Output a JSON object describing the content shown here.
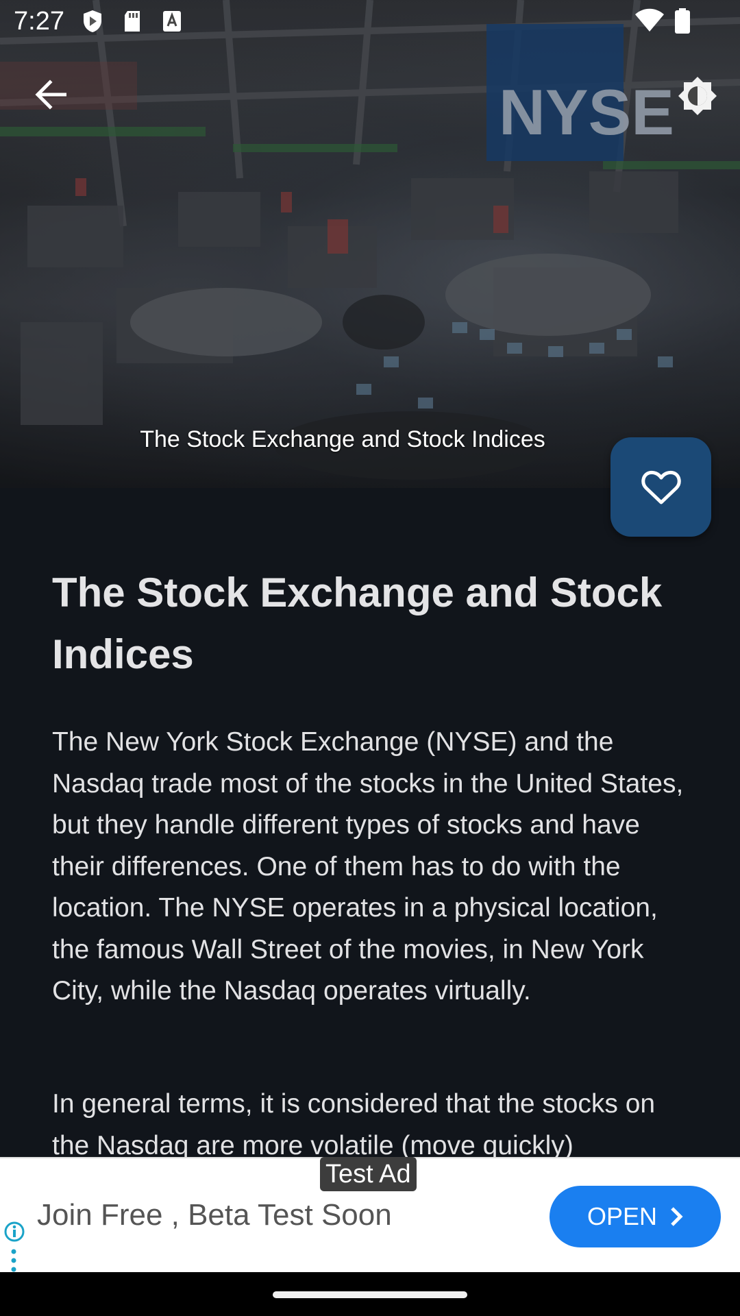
{
  "status_bar": {
    "time": "7:27"
  },
  "hero": {
    "caption": "The Stock Exchange and Stock Indices"
  },
  "article": {
    "title": "The Stock Exchange and Stock Indices",
    "paragraphs": [
      "The New York Stock Exchange (NYSE) and the Nasdaq trade most of the stocks in the United States, but they handle different types of stocks and have their differences. One of them has to do with the location. The NYSE operates in a physical location, the famous Wall Street of the movies, in New York City, while the Nasdaq operates virtually.",
      "In general terms, it is considered that the stocks on the Nasdaq are more volatile (move quickly)"
    ]
  },
  "ad": {
    "label": "Test Ad",
    "headline": "Join Free , Beta Test Soon",
    "cta": "OPEN"
  },
  "colors": {
    "background": "#11151b",
    "fab": "#1b4976",
    "ad_button": "#1a7ff0"
  }
}
